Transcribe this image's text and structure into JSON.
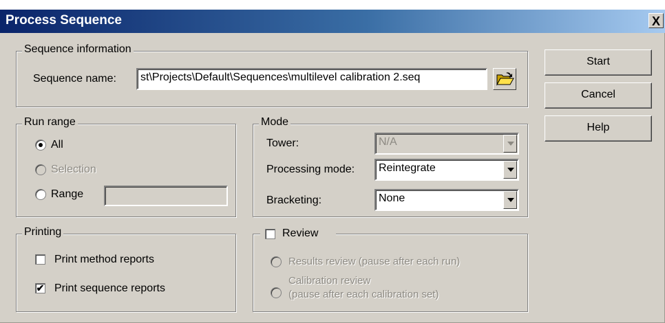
{
  "window": {
    "title": "Process Sequence",
    "close_glyph": "X"
  },
  "sequence_info": {
    "legend": "Sequence information",
    "name_label": "Sequence name:",
    "name_value": "st\\Projects\\Default\\Sequences\\multilevel calibration 2.seq",
    "browse_icon": "folder-open-icon"
  },
  "buttons": {
    "start": "Start",
    "cancel": "Cancel",
    "help": "Help"
  },
  "run_range": {
    "legend": "Run range",
    "all_label": "All",
    "selection_label": "Selection",
    "range_label": "Range",
    "range_value": "",
    "selected": "All"
  },
  "mode": {
    "legend": "Mode",
    "tower_label": "Tower:",
    "tower_value": "N/A",
    "processing_label": "Processing mode:",
    "processing_value": "Reintegrate",
    "bracketing_label": "Bracketing:",
    "bracketing_value": "None"
  },
  "printing": {
    "legend": "Printing",
    "method_label": "Print method reports",
    "method_checked": false,
    "sequence_label": "Print sequence reports",
    "sequence_checked": true
  },
  "review": {
    "label": "Review",
    "checked": false,
    "results_label": "Results review (pause after each run)",
    "calibration_label_line1": "Calibration review",
    "calibration_label_line2": "(pause after each calibration set)"
  }
}
